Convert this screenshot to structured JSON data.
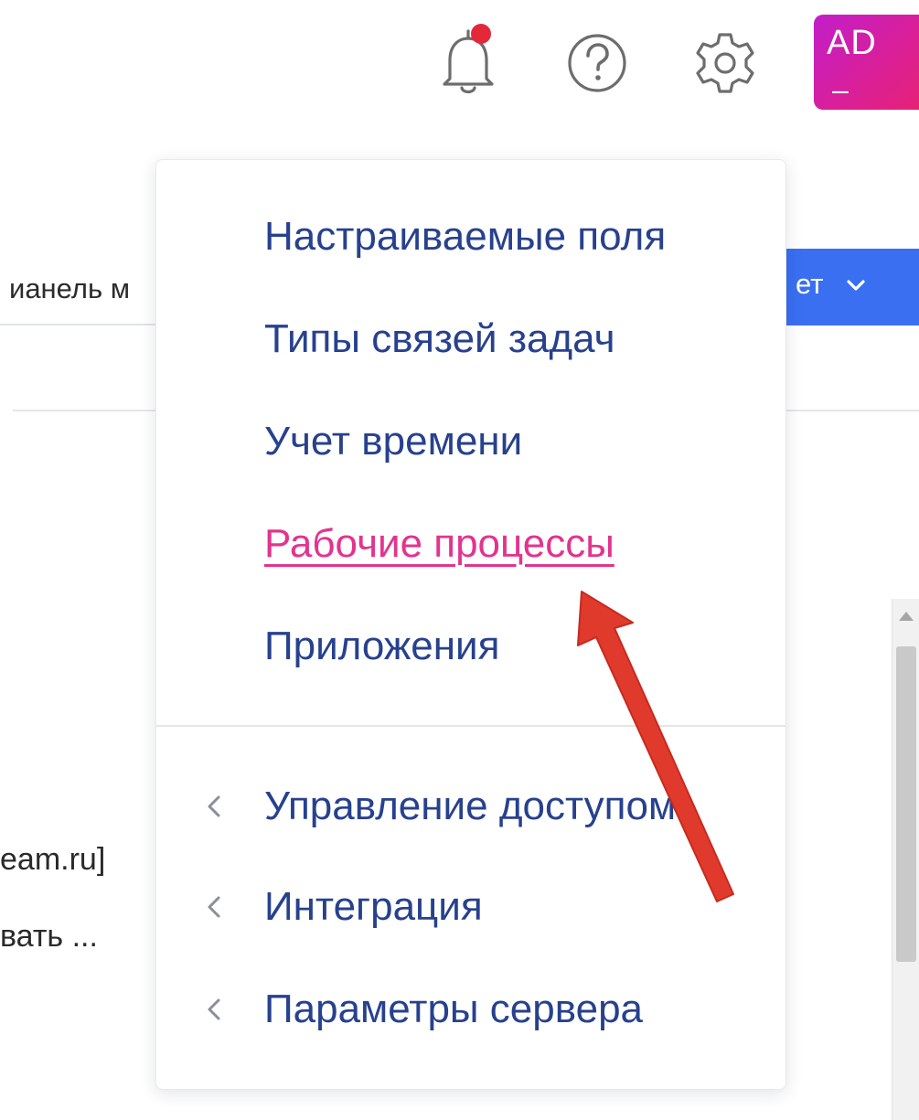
{
  "header": {
    "icons": [
      "bell-icon",
      "help-icon",
      "gear-icon"
    ],
    "notification_dot_color": "#e5273a",
    "avatar": {
      "initials": "AD",
      "dash": "–",
      "gradient": [
        "#c11fc9",
        "#e52275"
      ]
    }
  },
  "background": {
    "input_text": "ианель м",
    "button_label": "ет",
    "button_color": "#3a6ff2",
    "text_lines": [
      "eam.ru]",
      "вать ..."
    ]
  },
  "menu": {
    "items": [
      {
        "label": "Настраиваемые поля",
        "active": false
      },
      {
        "label": "Типы связей задач",
        "active": false
      },
      {
        "label": "Учет времени",
        "active": false
      },
      {
        "label": "Рабочие процессы",
        "active": true
      },
      {
        "label": "Приложения",
        "active": false
      }
    ],
    "submenus": [
      {
        "label": "Управление доступом"
      },
      {
        "label": "Интеграция"
      },
      {
        "label": "Параметры сервера"
      }
    ],
    "text_color": "#27418e",
    "active_color": "#e2348f"
  },
  "annotation": {
    "type": "red-arrow",
    "color": "#e03a2c",
    "points_to": "Рабочие процессы"
  }
}
